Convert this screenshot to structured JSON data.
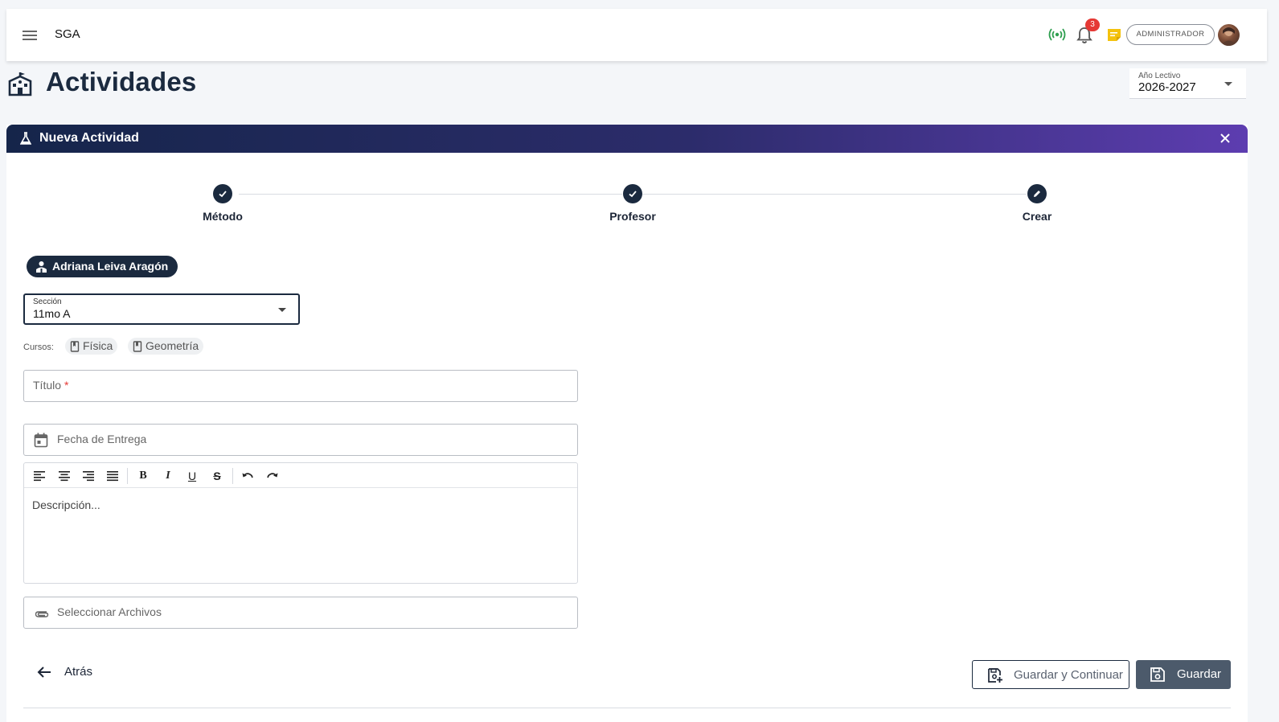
{
  "app": {
    "name": "SGA"
  },
  "header": {
    "notification_count": "3",
    "role": "ADMINISTRADOR",
    "icons": {
      "menu": "hamburger-menu-icon",
      "status": "broadcast-icon",
      "notifications": "bell-icon",
      "notes": "sticky-note-icon"
    },
    "colors": {
      "status": "#2e9e4f",
      "badge": "#e53935",
      "notes": "#f4c20d"
    }
  },
  "page": {
    "title": "Actividades",
    "icon": "school-building-icon",
    "year_select": {
      "label": "Año Lectivo",
      "value": "2026-2027"
    }
  },
  "panel": {
    "title": "Nueva Actividad",
    "icon": "flask-icon",
    "close_icon": "close-icon",
    "gradient": [
      "#15254a",
      "#5d3db0"
    ],
    "steps": [
      {
        "label": "Método",
        "state": "done",
        "icon": "check-icon"
      },
      {
        "label": "Profesor",
        "state": "done",
        "icon": "check-icon"
      },
      {
        "label": "Crear",
        "state": "active",
        "icon": "pencil-icon"
      }
    ],
    "teacher": "Adriana Leiva Aragón",
    "section": {
      "label": "Sección",
      "value": "11mo A"
    },
    "courses": {
      "label": "Cursos:",
      "items": [
        "Física",
        "Geometría"
      ]
    },
    "fields": {
      "title_label": "Título",
      "title_required": "*",
      "due_date_label": "Fecha de Entrega",
      "description_placeholder": "Descripción...",
      "files_label": "Seleccionar Archivos"
    },
    "editor_toolbar": {
      "bold": "B",
      "italic": "I",
      "underline": "U",
      "strike": "S",
      "icons": [
        "align-left-icon",
        "align-center-icon",
        "align-right-icon",
        "align-justify-icon",
        "bold-icon",
        "italic-icon",
        "underline-icon",
        "strikethrough-icon",
        "undo-icon",
        "redo-icon"
      ]
    },
    "actions": {
      "back": "Atrás",
      "save_continue": "Guardar y Continuar",
      "save": "Guardar"
    }
  }
}
